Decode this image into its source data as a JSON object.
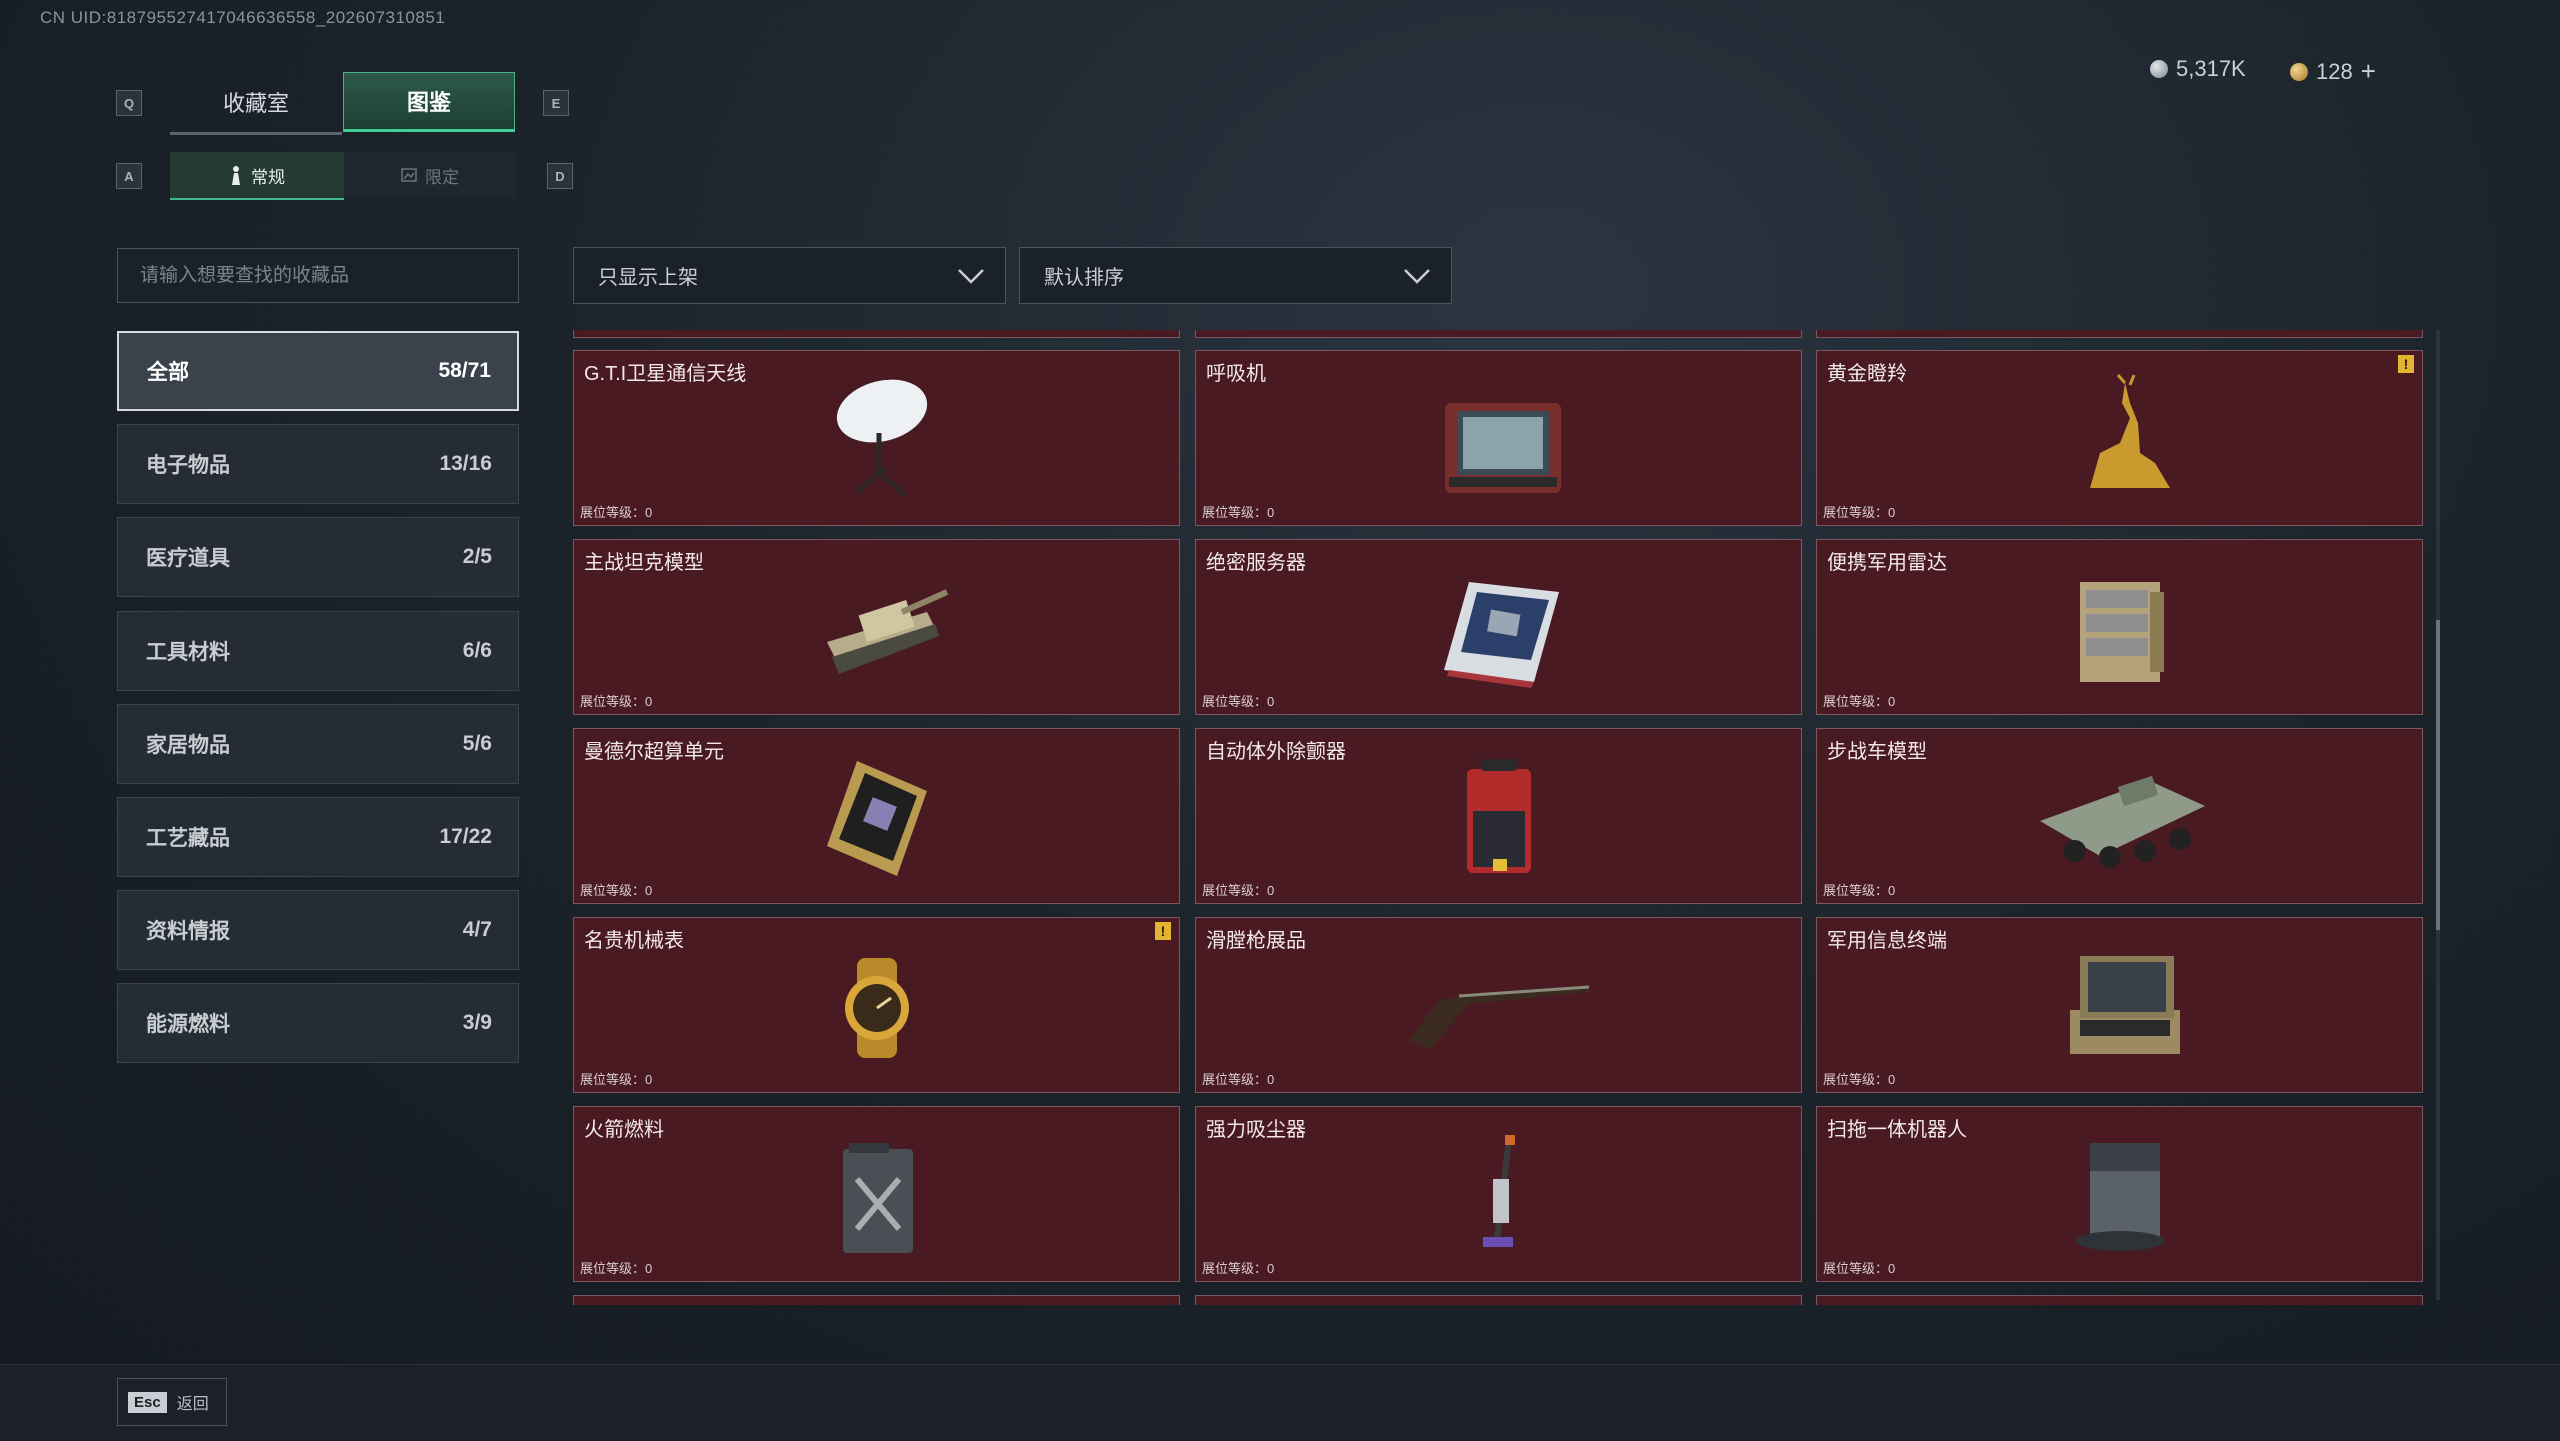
{
  "uid_text": "CN UID:818795527417046636558_202607310851",
  "tabs": {
    "key_left": "Q",
    "key_right": "E",
    "items": [
      {
        "label": "收藏室"
      },
      {
        "label": "图鉴"
      }
    ]
  },
  "subtabs": {
    "key_left": "A",
    "key_right": "D",
    "items": [
      {
        "label": "常规"
      },
      {
        "label": "限定"
      }
    ]
  },
  "currency": {
    "silver": "5,317K",
    "gold": "128",
    "add": "+"
  },
  "search": {
    "placeholder": "请输入想要查找的收藏品"
  },
  "filters": {
    "shelf_filter": "只显示上架",
    "sort": "默认排序"
  },
  "categories": [
    {
      "label": "全部",
      "count": "58/71"
    },
    {
      "label": "电子物品",
      "count": "13/16"
    },
    {
      "label": "医疗道具",
      "count": "2/5"
    },
    {
      "label": "工具材料",
      "count": "6/6"
    },
    {
      "label": "家居物品",
      "count": "5/6"
    },
    {
      "label": "工艺藏品",
      "count": "17/22"
    },
    {
      "label": "资料情报",
      "count": "4/7"
    },
    {
      "label": "能源燃料",
      "count": "3/9"
    }
  ],
  "level_label": "展位等级：0",
  "items": [
    {
      "name": "G.T.I卫星通信天线",
      "icon": "satellite-dish-icon"
    },
    {
      "name": "呼吸机",
      "icon": "ventilator-icon"
    },
    {
      "name": "黄金瞪羚",
      "icon": "golden-gazelle-icon",
      "warn": "!"
    },
    {
      "name": "主战坦克模型",
      "icon": "tank-model-icon"
    },
    {
      "name": "绝密服务器",
      "icon": "server-icon"
    },
    {
      "name": "便携军用雷达",
      "icon": "radar-icon"
    },
    {
      "name": "曼德尔超算单元",
      "icon": "supercomputer-icon"
    },
    {
      "name": "自动体外除颤器",
      "icon": "defibrillator-icon"
    },
    {
      "name": "步战车模型",
      "icon": "ifv-model-icon"
    },
    {
      "name": "名贵机械表",
      "icon": "watch-icon",
      "warn": "!"
    },
    {
      "name": "滑膛枪展品",
      "icon": "musket-icon"
    },
    {
      "name": "军用信息终端",
      "icon": "terminal-icon"
    },
    {
      "name": "火箭燃料",
      "icon": "fuel-can-icon"
    },
    {
      "name": "强力吸尘器",
      "icon": "vacuum-icon"
    },
    {
      "name": "扫拖一体机器人",
      "icon": "robot-vacuum-icon"
    }
  ],
  "footer": {
    "esc_key": "Esc",
    "back_label": "返回"
  }
}
